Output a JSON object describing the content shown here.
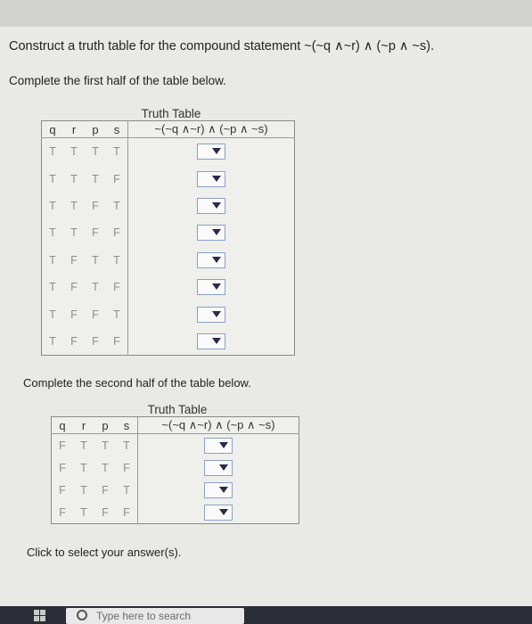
{
  "question": "Construct a truth table for the compound statement ~(~q ∧~r) ∧ (~p ∧ ~s).",
  "first_instruction": "Complete the first half of the table below.",
  "second_instruction": "Complete the second half of the table below.",
  "footer": "Click to select your answer(s).",
  "taskbar": {
    "search_placeholder": "Type here to search"
  },
  "table1": {
    "caption": "Truth Table",
    "headers": [
      "q",
      "r",
      "p",
      "s",
      "~(~q ∧~r) ∧ (~p ∧ ~s)"
    ],
    "rows": [
      [
        "T",
        "T",
        "T",
        "T"
      ],
      [
        "T",
        "T",
        "T",
        "F"
      ],
      [
        "T",
        "T",
        "F",
        "T"
      ],
      [
        "T",
        "T",
        "F",
        "F"
      ],
      [
        "T",
        "F",
        "T",
        "T"
      ],
      [
        "T",
        "F",
        "T",
        "F"
      ],
      [
        "T",
        "F",
        "F",
        "T"
      ],
      [
        "T",
        "F",
        "F",
        "F"
      ]
    ]
  },
  "table2": {
    "caption": "Truth Table",
    "headers": [
      "q",
      "r",
      "p",
      "s",
      "~(~q ∧~r) ∧ (~p ∧ ~s)"
    ],
    "rows": [
      [
        "F",
        "T",
        "T",
        "T"
      ],
      [
        "F",
        "T",
        "T",
        "F"
      ],
      [
        "F",
        "T",
        "F",
        "T"
      ],
      [
        "F",
        "T",
        "F",
        "F"
      ]
    ]
  }
}
